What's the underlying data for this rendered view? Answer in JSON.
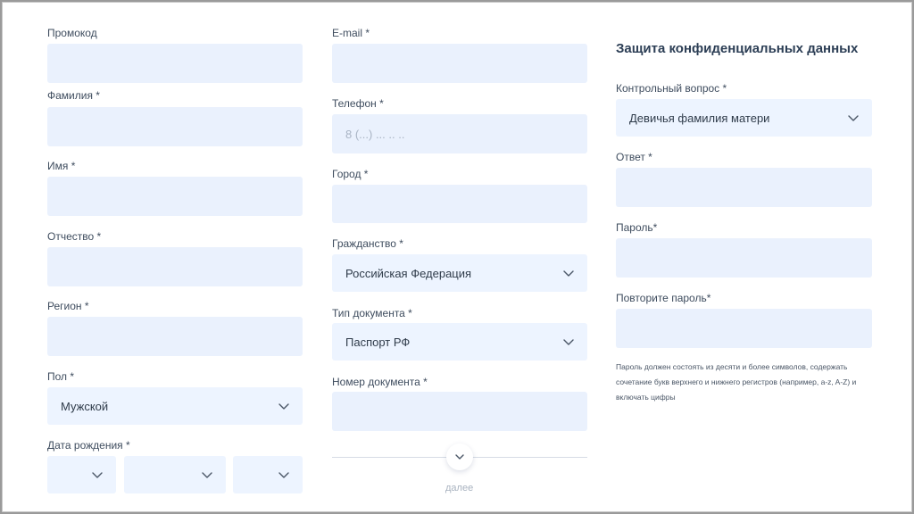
{
  "left": {
    "promo_label": "Промокод",
    "lastname_label": "Фамилия *",
    "firstname_label": "Имя *",
    "patronymic_label": "Отчество *",
    "region_label": "Регион *",
    "gender_label": "Пол *",
    "gender_value": "Мужской",
    "birthdate_label": "Дата рождения *"
  },
  "middle": {
    "email_label": "E-mail *",
    "phone_label": "Телефон *",
    "phone_placeholder": "8 (...) ... .. ..",
    "city_label": "Город *",
    "citizenship_label": "Гражданство *",
    "citizenship_value": "Российская Федерация",
    "doctype_label": "Тип документа *",
    "doctype_value": "Паспорт РФ",
    "docnumber_label": "Номер документа *",
    "more_label": "далее"
  },
  "right": {
    "section_title": "Защита конфиденциальных данных",
    "question_label": "Контрольный вопрос *",
    "question_value": "Девичья фамилия матери",
    "answer_label": "Ответ *",
    "password_label": "Пароль*",
    "repeat_password_label": "Повторите пароль*",
    "password_hint": "Пароль должен состоять из десяти и более символов, содержать сочетание букв верхнего и нижнего регистров (например, a-z, A-Z) и включать цифры"
  },
  "icons": {
    "chevron": "chevron-down-icon"
  },
  "colors": {
    "field_bg": "#eaf1fd",
    "select_bg": "#edf4ff",
    "text": "#3e4c5e",
    "title": "#2c3e55"
  }
}
